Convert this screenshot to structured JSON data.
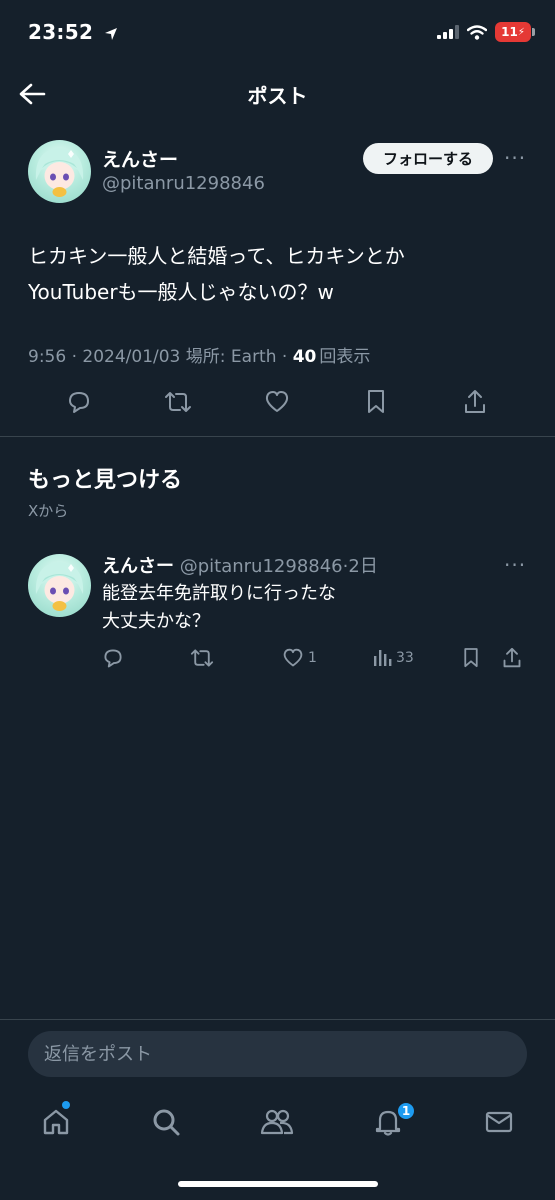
{
  "status_bar": {
    "time": "23:52",
    "battery": "11"
  },
  "header": {
    "title": "ポスト"
  },
  "post": {
    "author_name": "えんさー",
    "author_handle": "@pitanru1298846",
    "follow_label": "フォローする",
    "more": "···",
    "body_line1": "ヒカキン一般人と結婚って、ヒカキンとか",
    "body_line2": "YouTuberも一般人じゃないの？w",
    "meta_prefix": "9:56 · 2024/01/03 場所: Earth · ",
    "views_count": "40",
    "views_label": "回表示"
  },
  "discover": {
    "title": "もっと見つける",
    "subtitle": "Xから"
  },
  "related_post": {
    "author_name": "えんさー",
    "author_handle": "@pitanru1298846",
    "time": "·2日",
    "more": "···",
    "body_line1": "能登去年免許取りに行ったな",
    "body_line2": "大丈夫かな？",
    "likes": "1",
    "views": "33"
  },
  "reply": {
    "placeholder": "返信をポスト"
  },
  "nav": {
    "notification_count": "1"
  },
  "colors": {
    "background": "#15202b",
    "accent": "#1d9bf0",
    "secondary_text": "#8b98a5"
  }
}
